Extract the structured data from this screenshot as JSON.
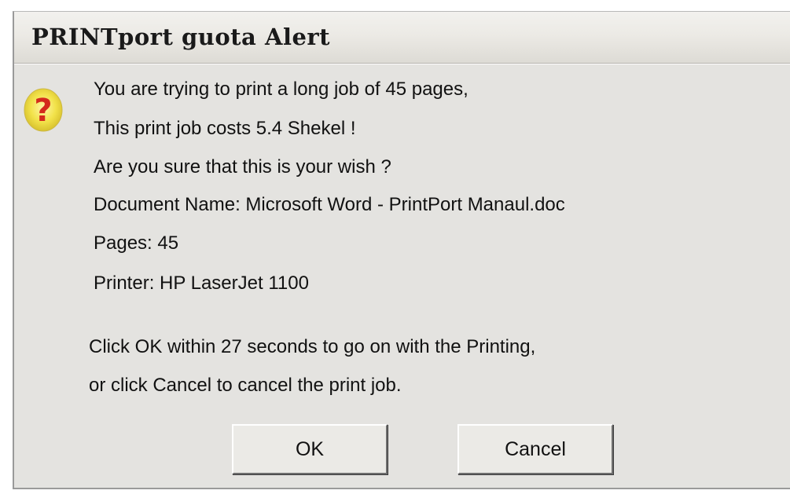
{
  "window": {
    "title": "PRINTport guota Alert"
  },
  "icon": {
    "name": "question-icon",
    "glyph": "?",
    "color": "#d42a1c",
    "background": "#f2e24a"
  },
  "message": {
    "lines": [
      "You are trying to print a long job of 45 pages,",
      "This print job costs 5.4 Shekel !",
      "Are you sure that this is your wish ?",
      "Document Name: Microsoft Word - PrintPort Manaul.doc",
      "Pages: 45",
      "Printer: HP LaserJet 1100"
    ],
    "instructions": [
      "Click OK within 27 seconds to go on with the Printing,",
      "or click Cancel to cancel the print job."
    ]
  },
  "buttons": {
    "ok_label": "OK",
    "cancel_label": "Cancel"
  }
}
